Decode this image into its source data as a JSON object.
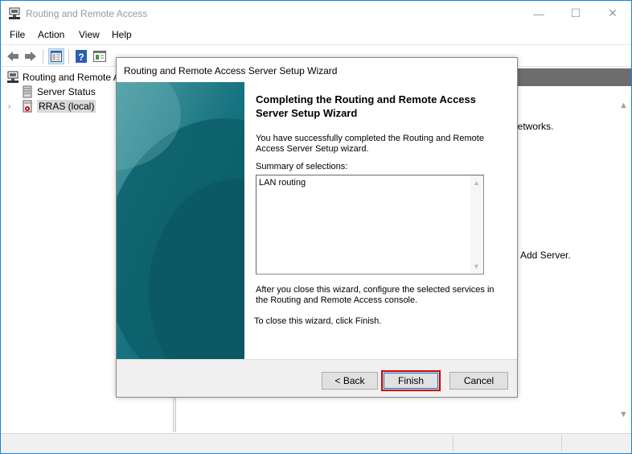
{
  "window": {
    "title": "Routing and Remote Access",
    "controls": {
      "minimize": "—",
      "maximize": "☐",
      "close": "✕"
    }
  },
  "menu": [
    "File",
    "Action",
    "View",
    "Help"
  ],
  "toolbar": {
    "buttons": [
      "back-arrow-icon",
      "forward-arrow-icon",
      "show-hide-tree-icon",
      "help-icon",
      "properties-icon"
    ]
  },
  "tree": {
    "root": "Routing and Remote A",
    "items": [
      {
        "label": "Server Status",
        "icon": "server-status-icon"
      },
      {
        "label": "RRAS (local)",
        "icon": "server-icon",
        "selected": true,
        "expander": "›"
      }
    ]
  },
  "right_pane": {
    "text1": "networks.",
    "text2": "Add Server."
  },
  "wizard": {
    "title": "Routing and Remote Access Server Setup Wizard",
    "heading": "Completing the Routing and Remote Access Server Setup Wizard",
    "success_text": "You have successfully completed the Routing and Remote Access Server Setup wizard.",
    "summary_label": "Summary of selections:",
    "summary_value": "LAN routing",
    "after_close_text": "After you close this wizard, configure the selected services in the Routing and  Remote Access console.",
    "close_instruction": "To close this wizard, click Finish.",
    "buttons": {
      "back": "< Back",
      "finish": "Finish",
      "cancel": "Cancel"
    }
  },
  "colors": {
    "banner_teal": "#0f6a76",
    "highlight_red": "#d40000",
    "window_border": "#1883d7"
  }
}
